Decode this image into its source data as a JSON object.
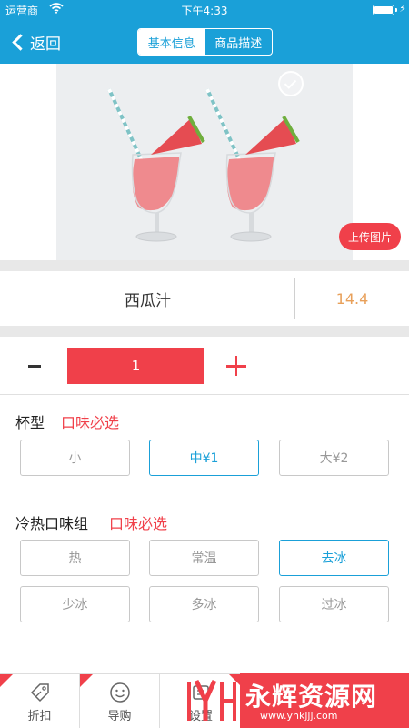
{
  "status_bar": {
    "carrier": "运营商",
    "time": "下午4:33",
    "icons": [
      "wifi-icon",
      "battery-icon",
      "charging-bolt-icon"
    ]
  },
  "nav": {
    "back_label": "返回",
    "tabs": [
      {
        "label": "基本信息",
        "selected": true
      },
      {
        "label": "商品描述",
        "selected": false
      }
    ]
  },
  "product": {
    "image_icon": "watermelon-juice-photo",
    "upload_label": "上传图片",
    "name": "西瓜汁",
    "price": "14.4"
  },
  "quantity": {
    "minus": "-",
    "value": "1",
    "plus": "+"
  },
  "groups": [
    {
      "title": "杯型",
      "hint": "口味必选",
      "options": [
        {
          "label": "小",
          "selected": false
        },
        {
          "label": "中¥1",
          "selected": true
        },
        {
          "label": "大¥2",
          "selected": false
        }
      ]
    },
    {
      "title": "冷热口味组",
      "hint": "口味必选",
      "options": [
        {
          "label": "热",
          "selected": false
        },
        {
          "label": "常温",
          "selected": false
        },
        {
          "label": "去冰",
          "selected": true
        },
        {
          "label": "少冰",
          "selected": false
        },
        {
          "label": "多冰",
          "selected": false
        },
        {
          "label": "过冰",
          "selected": false
        }
      ]
    }
  ],
  "tabbar": [
    {
      "label": "折扣",
      "icon": "discount-tag-icon"
    },
    {
      "label": "导购",
      "icon": "smiley-guide-icon"
    },
    {
      "label": "设置",
      "icon": "settings-icon"
    }
  ],
  "watermark": {
    "text": "永辉资源网",
    "url": "www.yhkjjj.com"
  },
  "colors": {
    "primary": "#1aa0d8",
    "accent_red": "#f0404a",
    "price": "#e8a05a"
  }
}
